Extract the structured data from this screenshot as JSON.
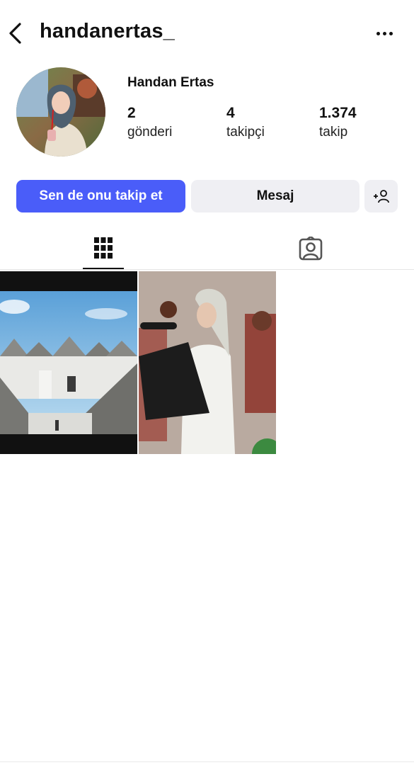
{
  "header": {
    "username": "handanertas_",
    "back_icon": "chevron-left-icon",
    "more_icon": "more-horizontal-icon"
  },
  "profile": {
    "full_name": "Handan Ertas",
    "stats": [
      {
        "value": "2",
        "label": "gönderi"
      },
      {
        "value": "4",
        "label": "takipçi"
      },
      {
        "value": "1.374",
        "label": "takip"
      }
    ]
  },
  "actions": {
    "follow_label": "Sen de onu takip et",
    "message_label": "Mesaj",
    "add_icon": "+person"
  },
  "tabs": [
    {
      "icon": "grid-icon",
      "active": true
    },
    {
      "icon": "tagged-person-icon",
      "active": false
    }
  ],
  "posts": [
    {
      "description": "trulli-houses-photo"
    },
    {
      "description": "woman-with-microphone-photo"
    }
  ],
  "colors": {
    "accent": "#4a5df9",
    "secondary_button": "#efeff3",
    "text": "#111111"
  }
}
